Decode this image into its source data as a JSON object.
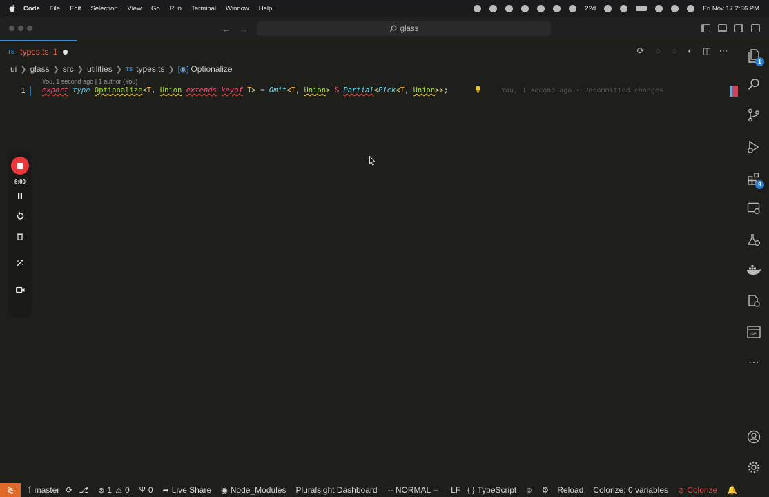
{
  "menubar": {
    "items": [
      "Code",
      "File",
      "Edit",
      "Selection",
      "View",
      "Go",
      "Run",
      "Terminal",
      "Window",
      "Help"
    ],
    "tray_days": "22d",
    "clock": "Fri Nov 17  2:36 PM"
  },
  "titlebar": {
    "search_text": "glass"
  },
  "tab": {
    "lang": "TS",
    "name": "types.ts",
    "problems": "1"
  },
  "breadcrumb": {
    "parts": [
      "ui",
      "glass",
      "src",
      "utilities",
      "types.ts",
      "Optionalize"
    ],
    "file_lang": "TS"
  },
  "editor": {
    "blame_lens": "You, 1 second ago | 1 author (You)",
    "line_number": "1",
    "tokens": [
      {
        "t": "export",
        "c": "kw"
      },
      {
        "t": " ",
        "c": "text"
      },
      {
        "t": "type",
        "c": "type-kw"
      },
      {
        "t": " ",
        "c": "text"
      },
      {
        "t": "Optionalize",
        "c": "name"
      },
      {
        "t": "<",
        "c": "punc"
      },
      {
        "t": "T",
        "c": "param"
      },
      {
        "t": ", ",
        "c": "text"
      },
      {
        "t": "Union",
        "c": "name"
      },
      {
        "t": " ",
        "c": "text"
      },
      {
        "t": "extends",
        "c": "kw"
      },
      {
        "t": " ",
        "c": "text"
      },
      {
        "t": "keyof",
        "c": "kw"
      },
      {
        "t": " ",
        "c": "text"
      },
      {
        "t": "T",
        "c": "param"
      },
      {
        "t": "> ",
        "c": "punc"
      },
      {
        "t": "= ",
        "c": "op"
      },
      {
        "t": "Omit",
        "c": "fn"
      },
      {
        "t": "<",
        "c": "punc"
      },
      {
        "t": "T",
        "c": "param"
      },
      {
        "t": ", ",
        "c": "text"
      },
      {
        "t": "Union",
        "c": "name"
      },
      {
        "t": "> ",
        "c": "punc"
      },
      {
        "t": "& ",
        "c": "op"
      },
      {
        "t": "Partial",
        "c": "fn-err"
      },
      {
        "t": "<",
        "c": "punc"
      },
      {
        "t": "Pick",
        "c": "fn"
      },
      {
        "t": "<",
        "c": "punc"
      },
      {
        "t": "T",
        "c": "param"
      },
      {
        "t": ", ",
        "c": "text"
      },
      {
        "t": "Union",
        "c": "name"
      },
      {
        "t": ">>",
        "c": "punc"
      },
      {
        "t": ";",
        "c": "text"
      }
    ],
    "blame_inline": "You, 1 second ago • Uncommitted changes"
  },
  "recorder": {
    "time": "6:00"
  },
  "activitybar": {
    "explorer_badge": "1",
    "extensions_badge": "3"
  },
  "statusbar": {
    "branch": "master",
    "errors": "1",
    "warnings": "0",
    "ports": "0",
    "live_share": "Live Share",
    "node_modules": "Node_Modules",
    "pluralsight": "Pluralsight Dashboard",
    "vim_mode": "-- NORMAL --",
    "eol": "LF",
    "language": "TypeScript",
    "reload": "Reload",
    "colorize_vars": "Colorize: 0 variables",
    "colorize": "Colorize"
  },
  "colors": {
    "accent_blue": "#2e8bd6",
    "record_red": "#e8383b",
    "remote_orange": "#e06a2a",
    "error_red": "#e8474c"
  }
}
